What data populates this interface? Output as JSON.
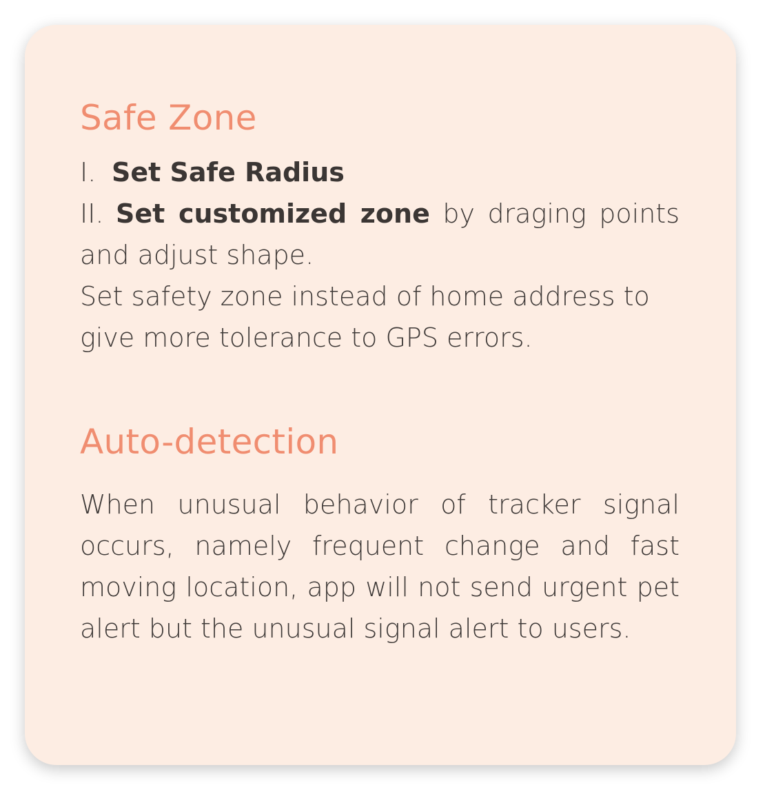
{
  "safe_zone": {
    "title": "Safe Zone",
    "item1": {
      "numeral": "I.",
      "label": "Set Safe Radius"
    },
    "item2": {
      "numeral": "II.",
      "label": "Set customized zone",
      "rest": "by draging points and adjust shape."
    },
    "note": "Set safety zone instead of home address to give more tolerance to GPS errors."
  },
  "auto_detection": {
    "title": "Auto-detection",
    "body": "When unusual behavior of tracker signal occurs, namely frequent change and fast moving location, app will not send urgent pet alert but the unusual signal alert to users."
  },
  "colors": {
    "card_background": "#fdede3",
    "heading": "#f08d70",
    "text": "#3f3a38"
  }
}
